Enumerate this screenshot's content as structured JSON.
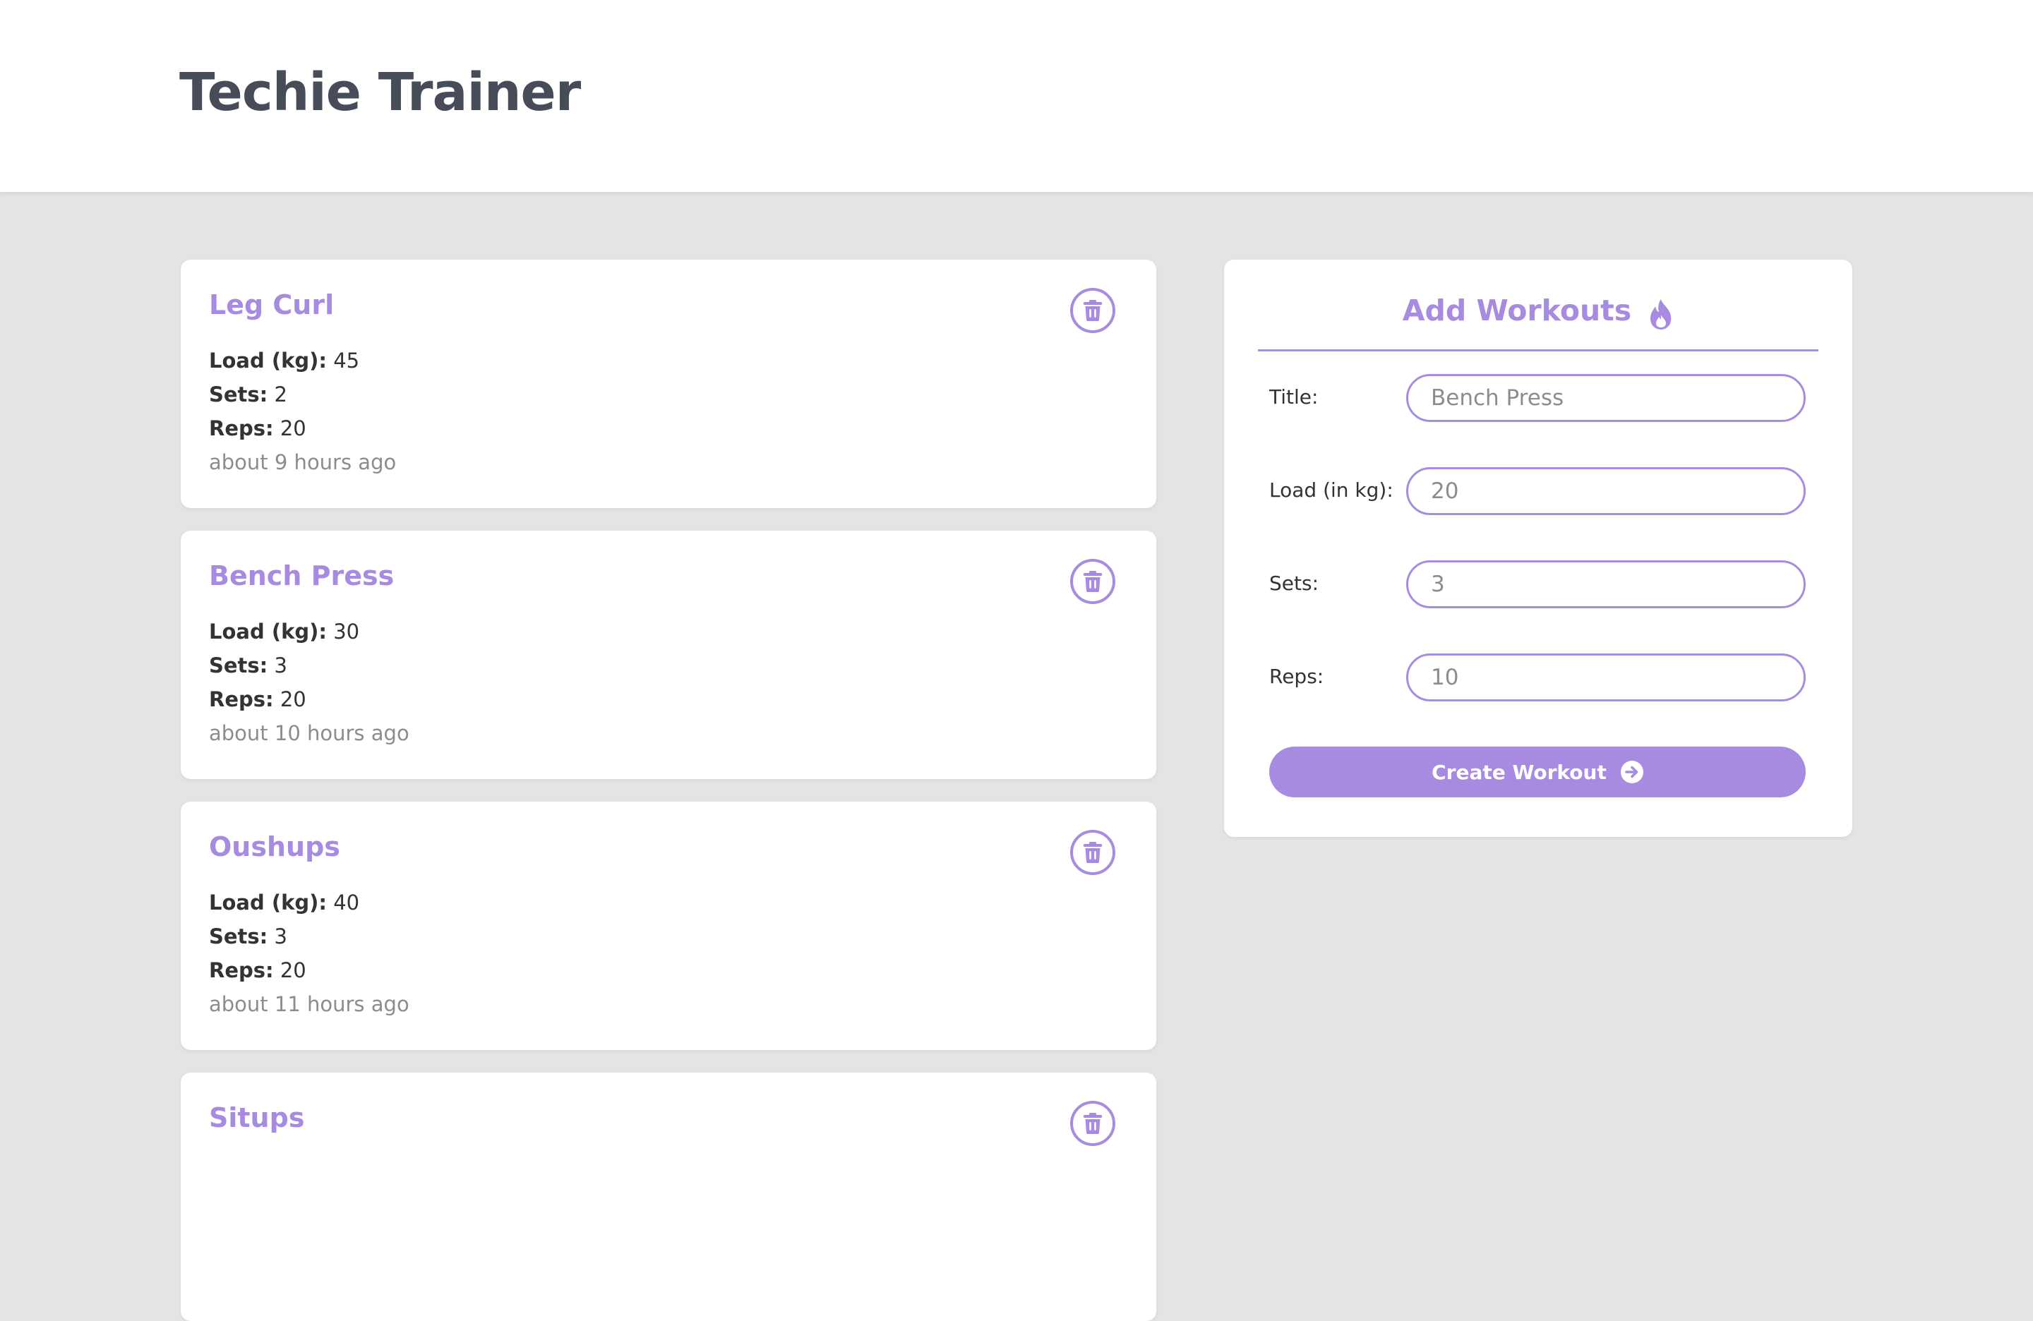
{
  "app": {
    "title": "Techie Trainer"
  },
  "colors": {
    "accent": "#a78be0",
    "text_dark": "#464c58",
    "muted": "#8c8c8c",
    "background": "#e4e4e4"
  },
  "workouts": [
    {
      "title": "Leg Curl",
      "load_label": "Load (kg):",
      "load": "45",
      "sets_label": "Sets:",
      "sets": "2",
      "reps_label": "Reps:",
      "reps": "20",
      "time": "about 9 hours ago",
      "delete_icon": "trash-icon"
    },
    {
      "title": "Bench Press",
      "load_label": "Load (kg):",
      "load": "30",
      "sets_label": "Sets:",
      "sets": "3",
      "reps_label": "Reps:",
      "reps": "20",
      "time": "about 10 hours ago",
      "delete_icon": "trash-icon"
    },
    {
      "title": "Oushups",
      "load_label": "Load (kg):",
      "load": "40",
      "sets_label": "Sets:",
      "sets": "3",
      "reps_label": "Reps:",
      "reps": "20",
      "time": "about 11 hours ago",
      "delete_icon": "trash-icon"
    },
    {
      "title": "Situps",
      "delete_icon": "trash-icon"
    }
  ],
  "form": {
    "heading": "Add Workouts",
    "heading_icon": "fire-icon",
    "title_label": "Title:",
    "title_placeholder": "Bench Press",
    "load_label": "Load (in kg):",
    "load_placeholder": "20",
    "sets_label": "Sets:",
    "sets_placeholder": "3",
    "reps_label": "Reps:",
    "reps_placeholder": "10",
    "submit_label": "Create Workout",
    "submit_icon": "arrow-right-circle-icon"
  }
}
